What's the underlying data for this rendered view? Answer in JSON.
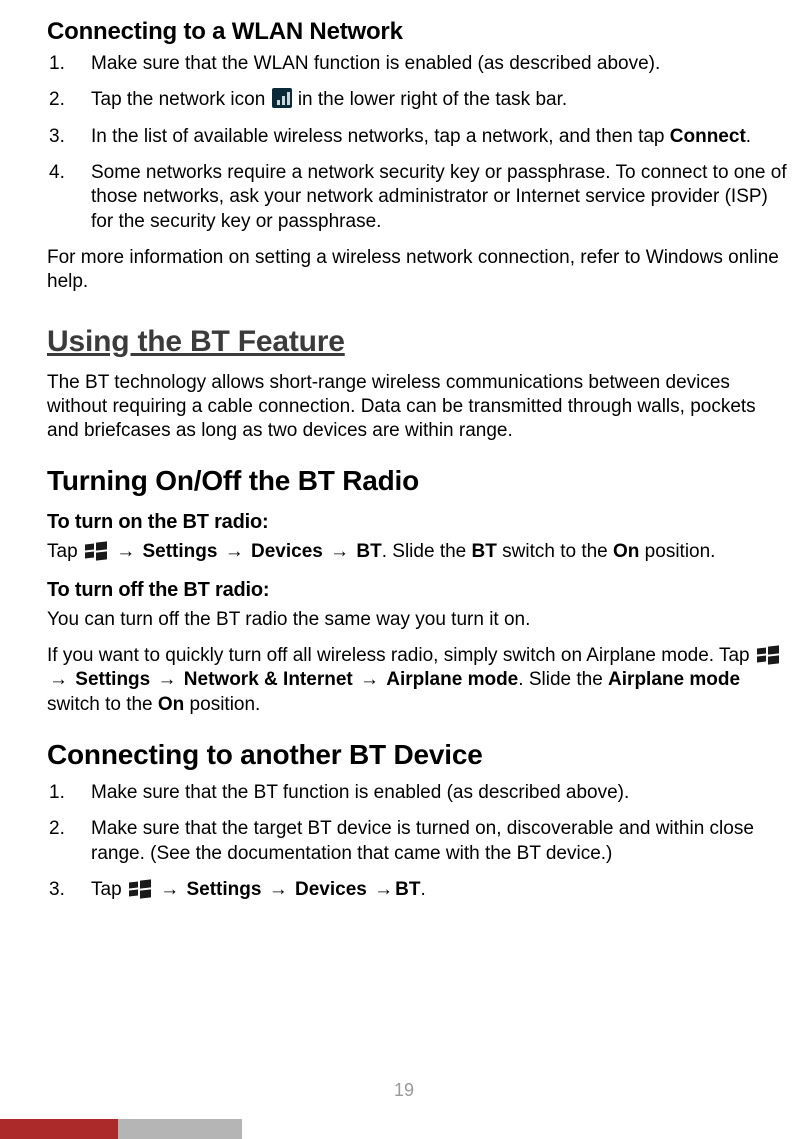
{
  "arrow": "→",
  "tapVerb": "Tap ",
  "sections": {
    "connectWlan": {
      "heading": "Connecting to a WLAN Network",
      "steps": {
        "s1": "Make sure that the WLAN function is enabled (as described above).",
        "s2a": "Tap the network icon",
        "s2b": " in the lower right of the task bar.",
        "s3a": "In the list of available wireless networks, tap a network, and then tap ",
        "s3b_bold": "Connect",
        "s3c": ".",
        "s4": "Some networks require a network security key or passphrase. To connect to one of those networks, ask your network administrator or Internet service provider (ISP) for the security key or passphrase."
      },
      "footnote": "For more information on setting a wireless network connection, refer to Windows online help."
    },
    "usingBt": {
      "heading": "Using the BT Feature",
      "intro": "The BT technology allows short-range wireless communications between devices without requiring a cable connection. Data can be transmitted through walls, pockets and briefcases as long as two devices are within range."
    },
    "turnOnOff": {
      "heading": "Turning On/Off the BT Radio",
      "onHeading": "To turn on the BT radio:",
      "onPath": {
        "settings": "Settings",
        "devices": "Devices",
        "bt": "BT"
      },
      "onTailA": ". Slide the ",
      "onTailB_bold": "BT",
      "onTailC": " switch to the ",
      "onTailD_bold": "On",
      "onTailE": " position.",
      "offHeading": "To turn off the BT radio:",
      "offLine1": "You can turn off the BT radio the same way you turn it on.",
      "offLine2a": "If you want to quickly turn off all wireless radio, simply switch on Airplane mode. Tap ",
      "offPath": {
        "settings": "Settings",
        "net": "Network & Internet",
        "air": "Airplane mode"
      },
      "offTailA": ". Slide the ",
      "offTailB_bold": "Airplane mode",
      "offTailC": " switch to the ",
      "offTailD_bold": "On",
      "offTailE": " position."
    },
    "connectBt": {
      "heading": "Connecting to another BT Device",
      "steps": {
        "s1": "Make sure that the BT function is enabled (as described above).",
        "s2": "Make sure that the target BT device is turned on, discoverable and within close range. (See the documentation that came with the BT device.)",
        "s3tap": "Tap ",
        "s3path": {
          "settings": "Settings",
          "devices": "Devices",
          "bt": "BT"
        },
        "s3dot": "."
      }
    }
  },
  "pageNumber": "19"
}
